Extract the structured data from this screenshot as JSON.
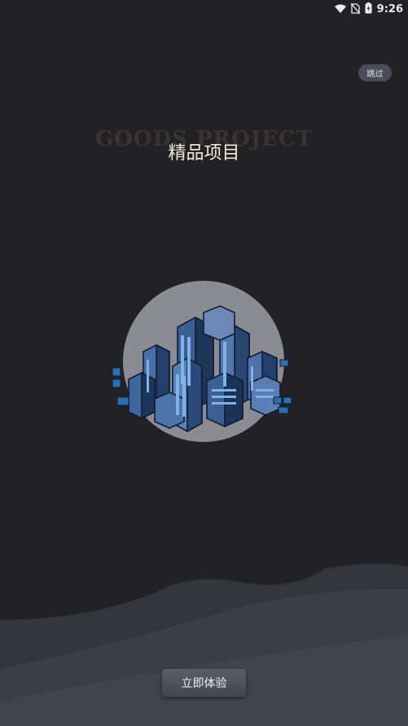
{
  "status_bar": {
    "time": "9:26"
  },
  "skip_button": {
    "label": "跳过"
  },
  "hero": {
    "bg_title": "GOODS PROJECT",
    "title": "精品项目"
  },
  "start_button": {
    "label": "立即体验"
  },
  "icons": [
    "wifi-icon",
    "no-sim-icon",
    "battery-icon",
    "city-buildings-illustration"
  ]
}
